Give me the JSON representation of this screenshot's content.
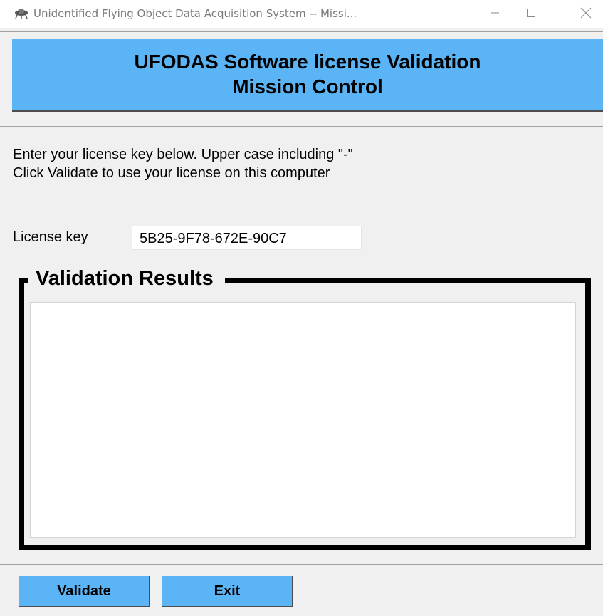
{
  "window": {
    "title": "Unidentified Flying Object Data Acquisition System -- Missi...",
    "icon": "ufo-icon",
    "controls": {
      "minimize": "minimize-icon",
      "maximize": "maximize-icon",
      "close": "close-icon"
    }
  },
  "banner": {
    "line1": "UFODAS Software license Validation",
    "line2": "Mission Control",
    "color": "#5ab4f5"
  },
  "instructions": {
    "line1": "Enter your license key below.  Upper case including \"-\"",
    "line2": "Click Validate to use your license on this computer"
  },
  "license": {
    "label": "License key",
    "value": "5B25-9F78-672E-90C7",
    "placeholder": ""
  },
  "results": {
    "legend": "Validation Results",
    "text": ""
  },
  "buttons": {
    "validate_label": "Validate",
    "exit_label": "Exit",
    "color": "#5ab4f5"
  }
}
